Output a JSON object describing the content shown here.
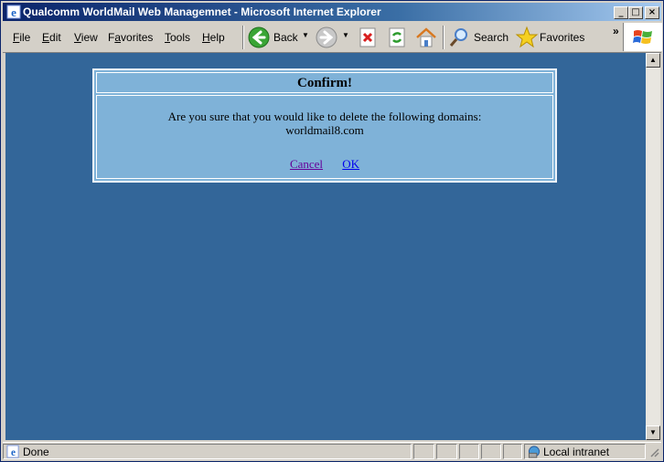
{
  "window": {
    "title": "Qualcomm WorldMail Web Managemnet - Microsoft Internet Explorer",
    "controls": {
      "minimize": "_",
      "maximize": "□",
      "close": "×"
    }
  },
  "menubar": {
    "items": [
      "File",
      "Edit",
      "View",
      "Favorites",
      "Tools",
      "Help"
    ],
    "mnemonics": [
      "F",
      "E",
      "V",
      "a",
      "T",
      "H"
    ]
  },
  "toolbar": {
    "back_label": "Back",
    "search_label": "Search",
    "favorites_label": "Favorites",
    "overflow": "»"
  },
  "dialog": {
    "title": "Confirm!",
    "message": "Are you sure that you would like to delete the following domains:",
    "domain": "worldmail8.com",
    "cancel_label": "Cancel",
    "ok_label": "OK"
  },
  "statusbar": {
    "status": "Done",
    "zone": "Local intranet"
  },
  "colors": {
    "page_bg": "#336699",
    "dialog_bg": "#7fb2d8",
    "visited_link": "#660099",
    "link": "#0000ee"
  }
}
